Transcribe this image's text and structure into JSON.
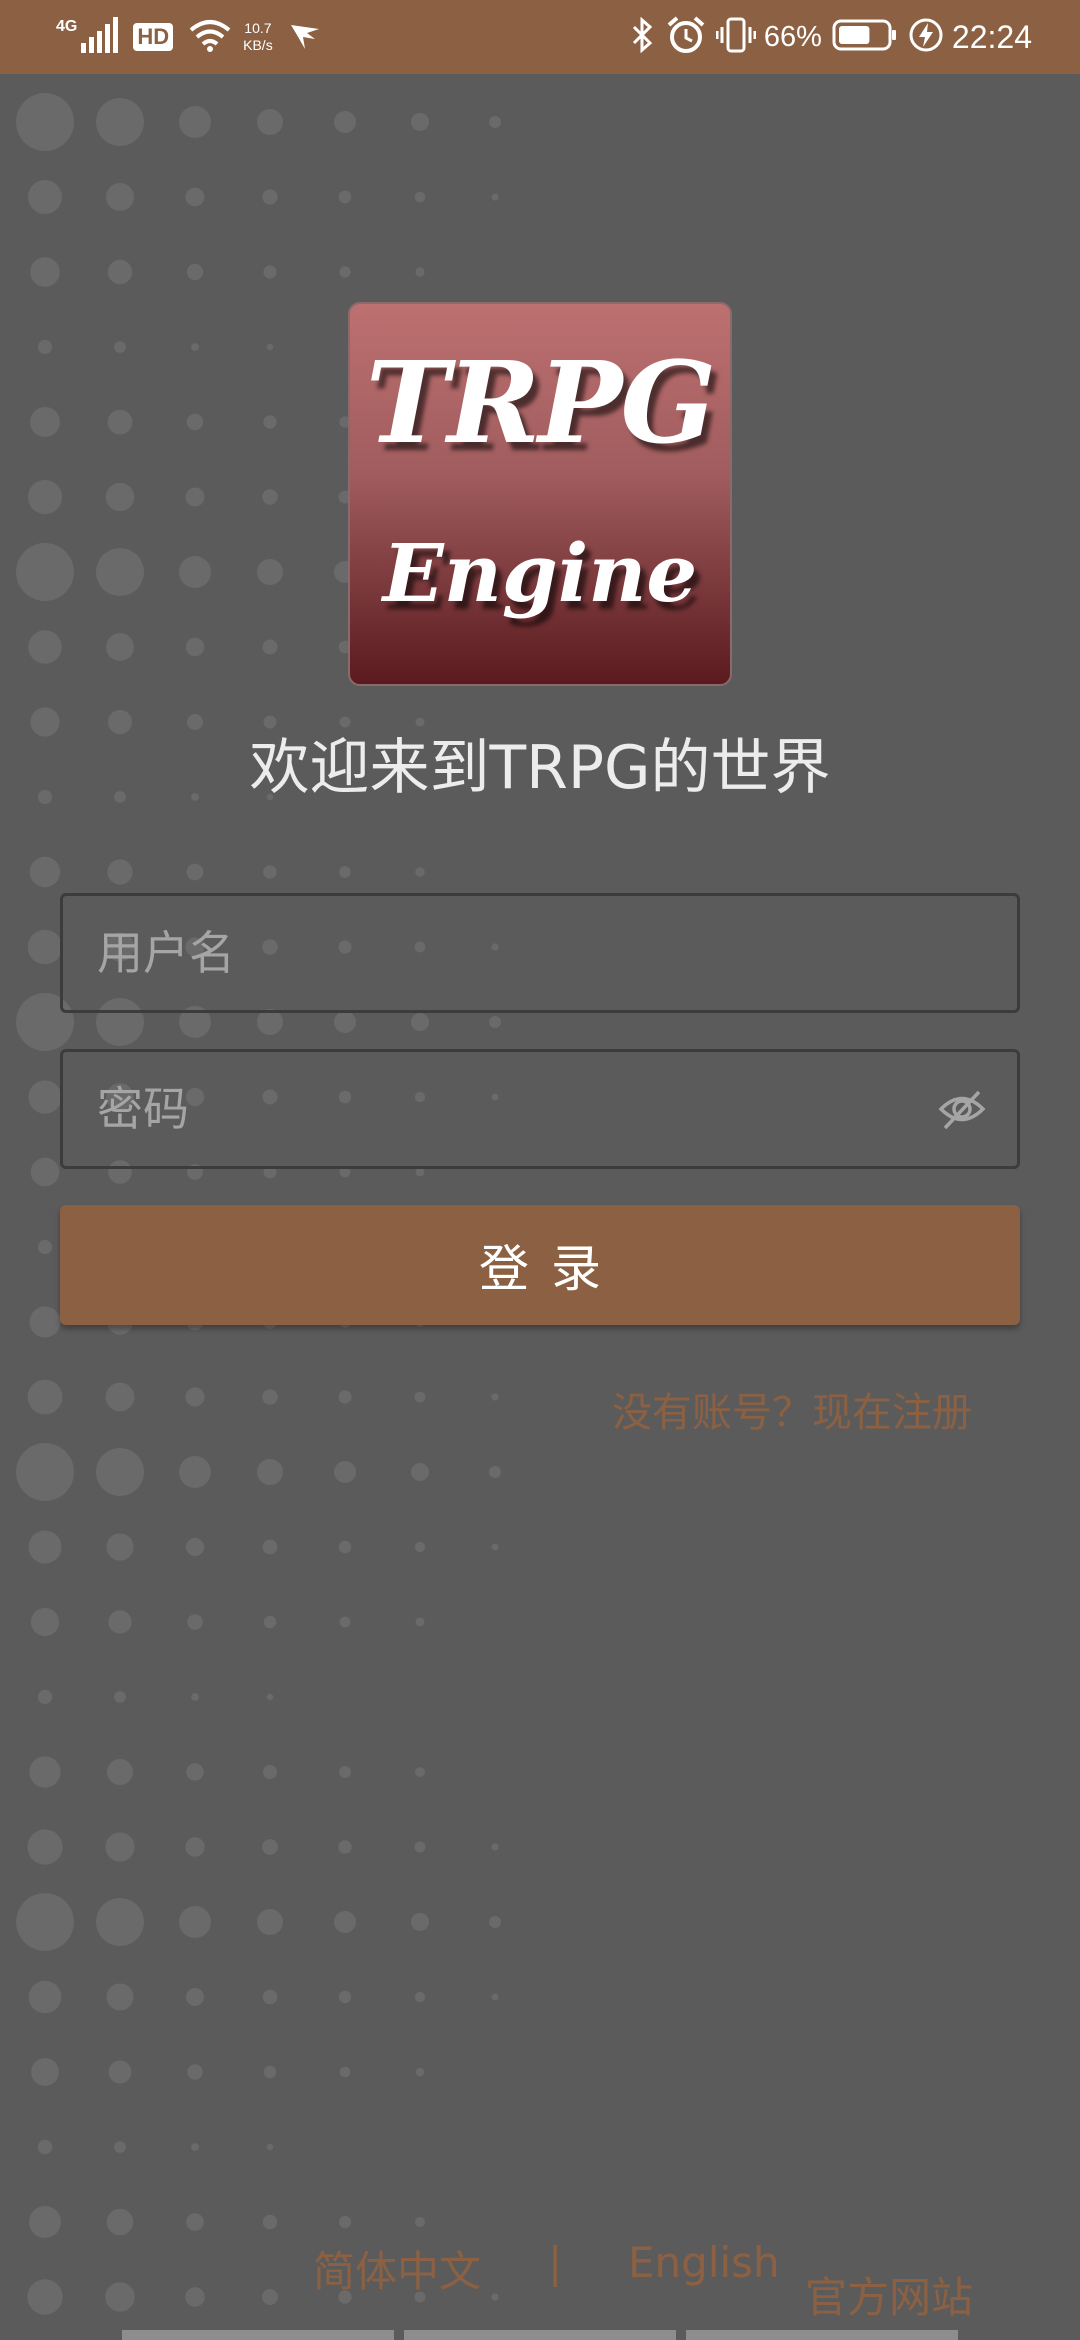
{
  "status_bar": {
    "network": "4G",
    "hd": "HD",
    "speed_value": "10.7",
    "speed_unit": "KB/s",
    "battery": "66%",
    "time": "22:24"
  },
  "logo": {
    "line1": "TRPG",
    "line2": "Engine"
  },
  "welcome": "欢迎来到TRPG的世界",
  "form": {
    "username_placeholder": "用户名",
    "password_placeholder": "密码",
    "login_label": "登录",
    "register_link": "没有账号？现在注册"
  },
  "footer": {
    "lang_zh": "简体中文",
    "separator": "|",
    "lang_en": "English",
    "official_site": "官方网站"
  },
  "colors": {
    "accent": "#8c6143",
    "background": "#5b5b5b",
    "dots": "#6a6a6a"
  }
}
